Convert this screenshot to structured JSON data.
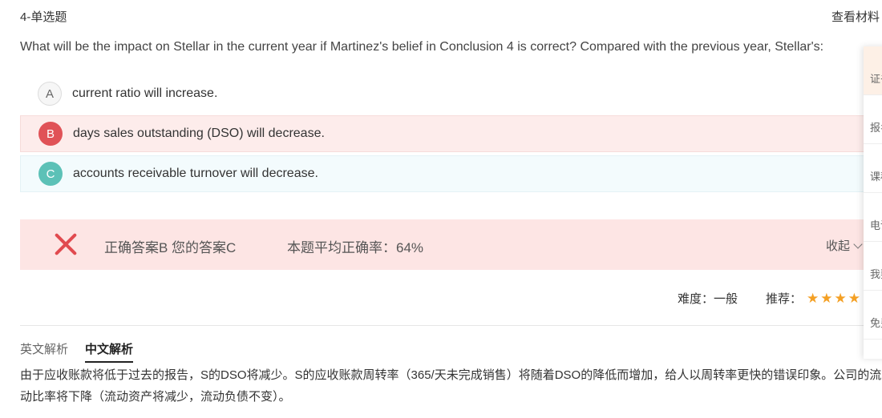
{
  "header": {
    "question_label": "4-单选题",
    "materials_link": "查看材料"
  },
  "question": {
    "text": "What will be the impact on Stellar in the current year if Martinez's belief in Conclusion 4 is correct? Compared with the previous year, Stellar's:"
  },
  "options": [
    {
      "letter": "A",
      "text": "current ratio will increase."
    },
    {
      "letter": "B",
      "text": "days sales outstanding (DSO) will decrease."
    },
    {
      "letter": "C",
      "text": "accounts receivable turnover will decrease."
    }
  ],
  "result": {
    "answer_text": "正确答案B 您的答案C",
    "avg_rate": "本题平均正确率：64%",
    "collapse_label": "收起"
  },
  "meta": {
    "difficulty": "难度：一般",
    "recommend_label": "推荐：",
    "stars_visible": 4
  },
  "tabs": {
    "english": "英文解析",
    "chinese": "中文解析"
  },
  "analysis": {
    "text": "由于应收账款将低于过去的报告，S的DSO将减少。S的应收账款周转率（365/天未完成销售）将随着DSO的降低而增加，给人以周转率更快的错误印象。公司的流动比率将下降（流动资产将减少，流动负债不变）。"
  },
  "side_panel": {
    "items": [
      "证书",
      "报名",
      "课程",
      "电话",
      "我要",
      "免费"
    ]
  },
  "colors": {
    "wrong": "#e14a4f",
    "option_b": "#e05257",
    "option_c": "#5cc1b7",
    "star": "#f4a024"
  }
}
